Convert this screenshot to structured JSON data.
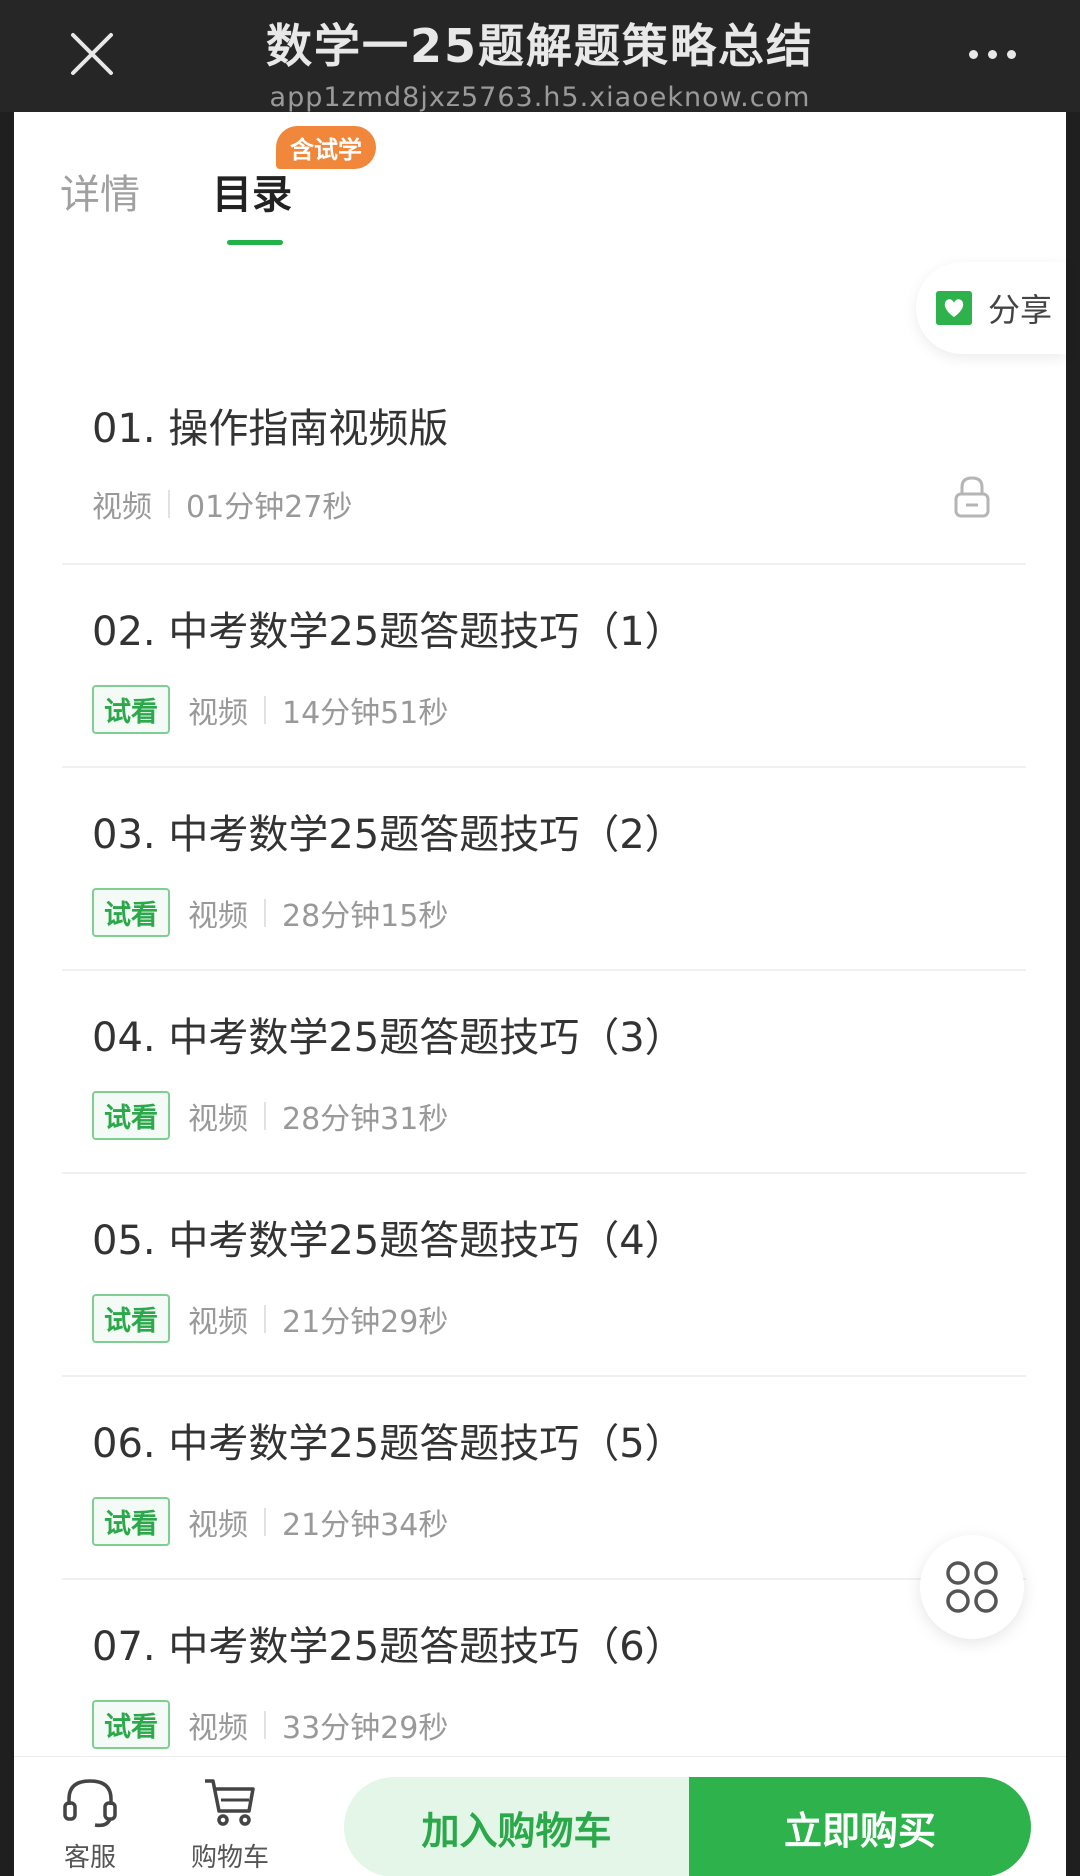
{
  "header": {
    "title": "数学一25题解题策略总结",
    "url": "app1zmd8jxz5763.h5.xiaoeknow.com"
  },
  "tabs": {
    "detail": "详情",
    "catalog": "目录",
    "trial_badge": "含试学"
  },
  "share": {
    "label": "分享"
  },
  "lessons": [
    {
      "title": "01. 操作指南视频版",
      "trial": false,
      "type": "视频",
      "duration": "01分钟27秒",
      "locked": true
    },
    {
      "title": "02. 中考数学25题答题技巧（1）",
      "trial": true,
      "trial_label": "试看",
      "type": "视频",
      "duration": "14分钟51秒"
    },
    {
      "title": "03. 中考数学25题答题技巧（2）",
      "trial": true,
      "trial_label": "试看",
      "type": "视频",
      "duration": "28分钟15秒"
    },
    {
      "title": "04. 中考数学25题答题技巧（3）",
      "trial": true,
      "trial_label": "试看",
      "type": "视频",
      "duration": "28分钟31秒"
    },
    {
      "title": "05. 中考数学25题答题技巧（4）",
      "trial": true,
      "trial_label": "试看",
      "type": "视频",
      "duration": "21分钟29秒"
    },
    {
      "title": "06. 中考数学25题答题技巧（5）",
      "trial": true,
      "trial_label": "试看",
      "type": "视频",
      "duration": "21分钟34秒"
    },
    {
      "title": "07. 中考数学25题答题技巧（6）",
      "trial": true,
      "trial_label": "试看",
      "type": "视频",
      "duration": "33分钟29秒"
    }
  ],
  "bottom_bar": {
    "service_label": "客服",
    "cart_label": "购物车",
    "add_to_cart": "加入购物车",
    "buy_now": "立即购买"
  },
  "colors": {
    "accent_green": "#2eb24c",
    "badge_orange": "#f0873a"
  }
}
